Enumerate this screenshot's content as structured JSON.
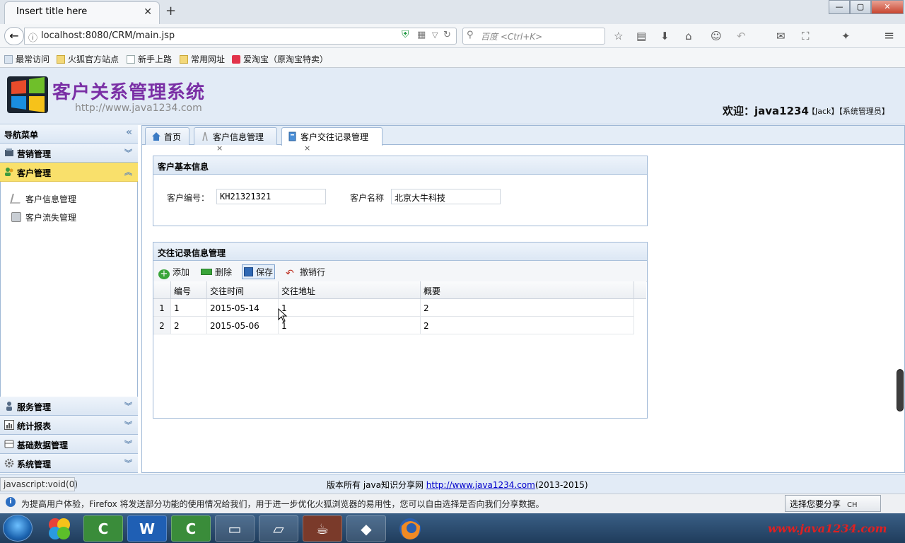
{
  "browser": {
    "tab_title": "Insert title here",
    "tab_close": "✕",
    "new_tab": "+",
    "url": "localhost:8080/CRM/main.jsp",
    "search_placeholder": "百度 <Ctrl+K>",
    "bookmarks": [
      "最常访问",
      "火狐官方站点",
      "新手上路",
      "常用网址",
      "爱淘宝（原淘宝特卖）"
    ],
    "window_buttons": [
      "—",
      "▢",
      "✕"
    ]
  },
  "app": {
    "title": "客户关系管理系统",
    "subtitle": "http://www.java1234.com",
    "welcome": "欢迎：java1234",
    "welcome_sub": "【Jack】【系统管理员】"
  },
  "sidebar": {
    "title": "导航菜单",
    "collapse": "«",
    "sections": [
      {
        "label": "营销管理",
        "icon": "marketing-icon"
      },
      {
        "label": "客户管理",
        "icon": "customer-icon",
        "selected": true
      },
      {
        "label": "服务管理",
        "icon": "service-icon"
      },
      {
        "label": "统计报表",
        "icon": "report-icon"
      },
      {
        "label": "基础数据管理",
        "icon": "database-icon"
      },
      {
        "label": "系统管理",
        "icon": "gear-icon"
      }
    ],
    "sub_items": [
      "客户信息管理",
      "客户流失管理"
    ]
  },
  "tabs": [
    {
      "label": "首页",
      "closable": false
    },
    {
      "label": "客户信息管理",
      "closable": true
    },
    {
      "label": "客户交往记录管理",
      "closable": true,
      "active": true
    }
  ],
  "tab_close": "×",
  "basic_info": {
    "title": "客户基本信息",
    "code_label": "客户编号：",
    "code_value": "KH21321321",
    "name_label": "客户名称",
    "name_value": "北京大牛科技"
  },
  "records": {
    "title": "交往记录信息管理",
    "toolbar": [
      "添加",
      "删除",
      "保存",
      "撤销行"
    ],
    "columns": [
      "编号",
      "交往时间",
      "交往地址",
      "概要"
    ],
    "rows": [
      {
        "rownum": "1",
        "id": "1",
        "date": "2015-05-14",
        "address": "1",
        "summary": "2"
      },
      {
        "rownum": "2",
        "id": "2",
        "date": "2015-05-06",
        "address": "1",
        "summary": "2"
      }
    ]
  },
  "footer": {
    "prefix": "版本所有 java知识分享网 ",
    "link": "http://www.java1234.com",
    "suffix": "(2013-2015)",
    "status_url": "javascript:void(0)"
  },
  "notification": {
    "text": "为提高用户体验，Firefox 将发送部分功能的使用情况给我们，用于进一步优化火狐浏览器的易用性，您可以自由选择是否向我们分享数据。",
    "button": "选择您要分享"
  },
  "taskbar": {
    "apps": [
      "C",
      "W",
      "C"
    ],
    "watermark": "www.java1234.com",
    "tray": "CH"
  }
}
